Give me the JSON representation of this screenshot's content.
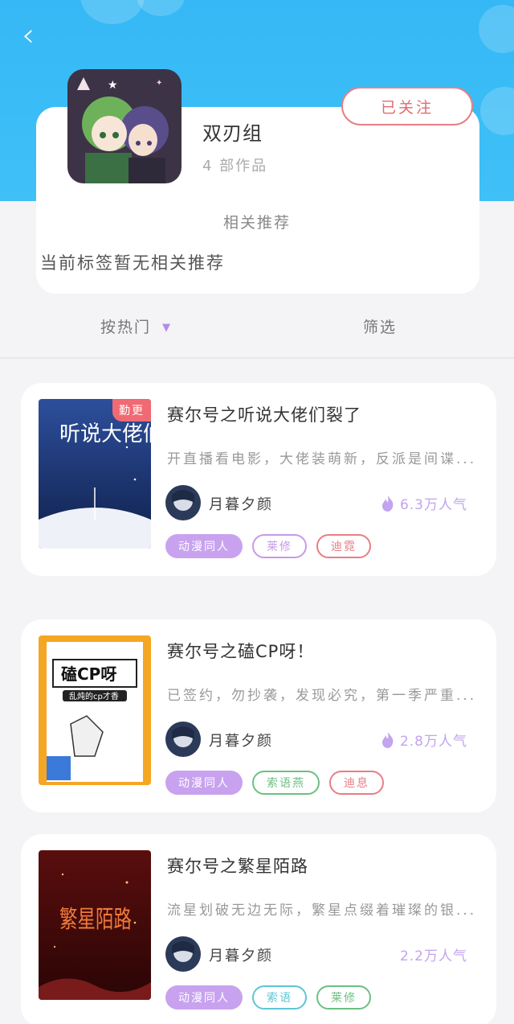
{
  "colors": {
    "accent": "#38bbf6",
    "follow": "#e06a73",
    "tag_primary": "#c8a2ef",
    "heat": "#c3a4ee"
  },
  "nav": {
    "back_icon": "chevron-left-icon"
  },
  "author": {
    "name": "双刃组",
    "works_count": "4 部作品",
    "follow_label": "已关注"
  },
  "recommend": {
    "title": "相关推荐",
    "empty_text": "当前标签暂无相关推荐"
  },
  "sort": {
    "hot_label": "按热门",
    "filter_label": "筛选"
  },
  "books": [
    {
      "title": "赛尔号之听说大佬们裂了",
      "description": "开直播看电影，大佬装萌新，反派是间谍...",
      "author": "月暮夕颜",
      "heat": "6.3万人气",
      "badge": "勤更",
      "cover_text": "听说大佬们裂了",
      "tags": [
        {
          "label": "动漫同人",
          "style": "solid",
          "color": "#c8a2ef"
        },
        {
          "label": "莱修",
          "style": "outline",
          "color": "#c79ae8"
        },
        {
          "label": "迪霓",
          "style": "outline",
          "color": "#ea7d84"
        }
      ]
    },
    {
      "title": "赛尔号之磕CP呀！",
      "description": "已签约，勿抄袭，发现必究，第一季严重...",
      "author": "月暮夕颜",
      "heat": "2.8万人气",
      "badge": "",
      "cover_text": "磕CP呀",
      "cover_subtext": "乱炖的cp才香",
      "tags": [
        {
          "label": "动漫同人",
          "style": "solid",
          "color": "#c8a2ef"
        },
        {
          "label": "索语燕",
          "style": "outline",
          "color": "#6dbf82"
        },
        {
          "label": "迪息",
          "style": "outline",
          "color": "#ea7d84"
        }
      ]
    },
    {
      "title": "赛尔号之繁星陌路",
      "description": "流星划破无边无际，繁星点缀着璀璨的银...",
      "author": "月暮夕颜",
      "heat": "2.2万人气",
      "badge": "",
      "cover_text": "繁星陌路",
      "tags": [
        {
          "label": "动漫同人",
          "style": "solid",
          "color": "#c8a2ef"
        },
        {
          "label": "索语",
          "style": "outline",
          "color": "#5cc6d6"
        },
        {
          "label": "莱修",
          "style": "outline",
          "color": "#6dbf82"
        }
      ]
    }
  ]
}
